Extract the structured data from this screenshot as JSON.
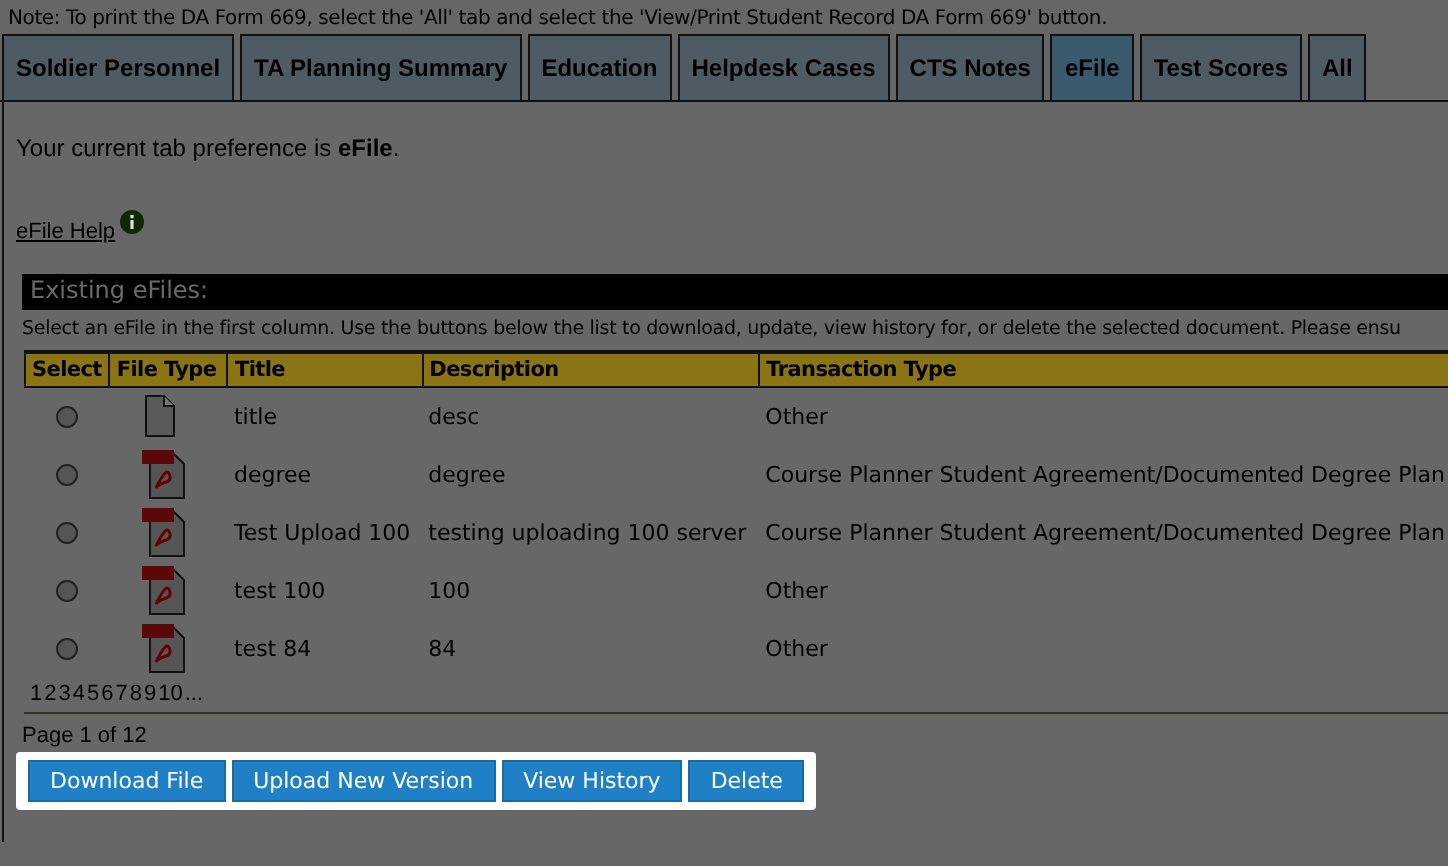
{
  "note": "Note: To print the DA Form 669, select the 'All' tab and select the 'View/Print Student Record DA Form 669' button.",
  "tabs": [
    {
      "label": "Soldier Personnel",
      "selected": false
    },
    {
      "label": "TA Planning Summary",
      "selected": false
    },
    {
      "label": "Education",
      "selected": false
    },
    {
      "label": "Helpdesk Cases",
      "selected": false
    },
    {
      "label": "CTS Notes",
      "selected": false
    },
    {
      "label": "eFile",
      "selected": true
    },
    {
      "label": "Test Scores",
      "selected": false
    },
    {
      "label": "All",
      "selected": false
    }
  ],
  "preference": "Your current tab preference is **eFile**.",
  "help_link": "eFile Help",
  "section_title": "Existing eFiles:",
  "instructions": "Select an eFile in the first column. Use the buttons below the list to download, update, view history for, or delete the selected document. Please ensu",
  "table": {
    "columns": [
      "Select",
      "File Type",
      "Title",
      "Description",
      "Transaction Type"
    ],
    "rows": [
      {
        "selected": false,
        "kind": "generic",
        "title": "title",
        "description": "desc",
        "transaction_type": "Other"
      },
      {
        "selected": false,
        "kind": "pdf",
        "title": "degree",
        "description": "degree",
        "transaction_type": "Course Planner Student Agreement/Documented Degree Plan"
      },
      {
        "selected": false,
        "kind": "pdf",
        "title": "Test Upload 100",
        "description": "testing uploading 100 server",
        "transaction_type": "Course Planner Student Agreement/Documented Degree Plan"
      },
      {
        "selected": false,
        "kind": "pdf",
        "title": "test 100",
        "description": "100",
        "transaction_type": "Other"
      },
      {
        "selected": false,
        "kind": "pdf",
        "title": "test 84",
        "description": "84",
        "transaction_type": "Other"
      }
    ]
  },
  "pagination": [
    "1",
    "2",
    "3",
    "4",
    "5",
    "6",
    "7",
    "8",
    "9",
    "10",
    "..."
  ],
  "page_status": "Page 1 of 12",
  "buttons": [
    "Download File",
    "Upload New Version",
    "View History",
    "Delete"
  ]
}
